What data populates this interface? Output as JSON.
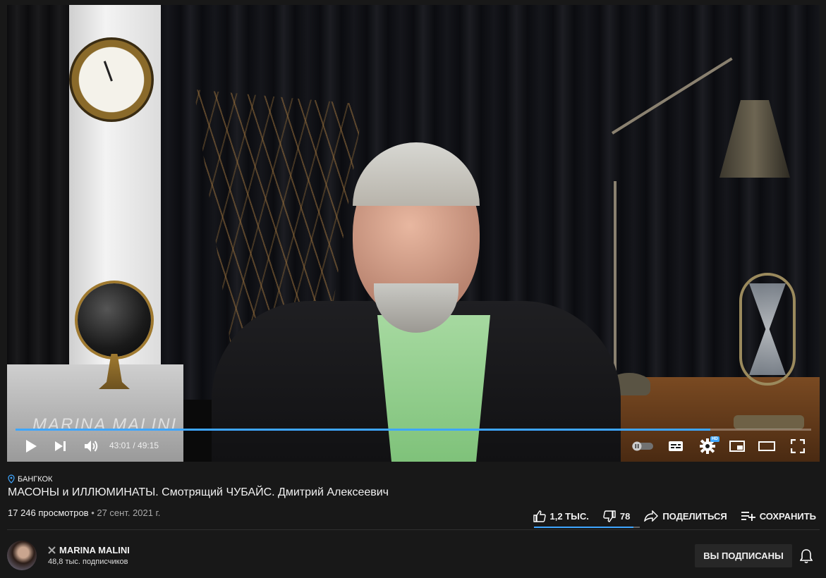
{
  "video": {
    "watermark": "MARINA MALINI",
    "current_time": "43:01",
    "duration": "49:15",
    "time_display": "43:01 / 49:15",
    "progress_fraction": 0.873,
    "hd_badge": "HD",
    "accent_color": "#3ea6ff"
  },
  "info": {
    "location": "БАНГКОК",
    "title": "МАСОНЫ и ИЛЛЮМИНАТЫ. Смотрящий ЧУБАЙС. Дмитрий Алексеевич",
    "views": "17 246 просмотров",
    "separator": " • ",
    "date": "27 сент. 2021 г."
  },
  "actions": {
    "like_count": "1,2 ТЫС.",
    "dislike_count": "78",
    "share_label": "ПОДЕЛИТЬСЯ",
    "save_label": "СОХРАНИТЬ",
    "like_ratio": 0.94
  },
  "channel": {
    "name": "MARINA MALINI",
    "subscribers": "48,8 тыс. подписчиков",
    "subscribe_button": "ВЫ ПОДПИСАНЫ"
  },
  "icons": {
    "play": "play-icon",
    "next": "next-icon",
    "volume": "volume-icon",
    "autoplay": "autoplay-toggle-icon",
    "subtitles": "subtitles-icon",
    "settings": "gear-icon",
    "miniplayer": "miniplayer-icon",
    "theater": "theater-icon",
    "fullscreen": "fullscreen-icon",
    "location": "location-pin-icon",
    "like": "thumbs-up-icon",
    "dislike": "thumbs-down-icon",
    "share": "share-icon",
    "save": "playlist-add-icon",
    "verified": "x-mark-icon",
    "bell": "bell-icon"
  }
}
